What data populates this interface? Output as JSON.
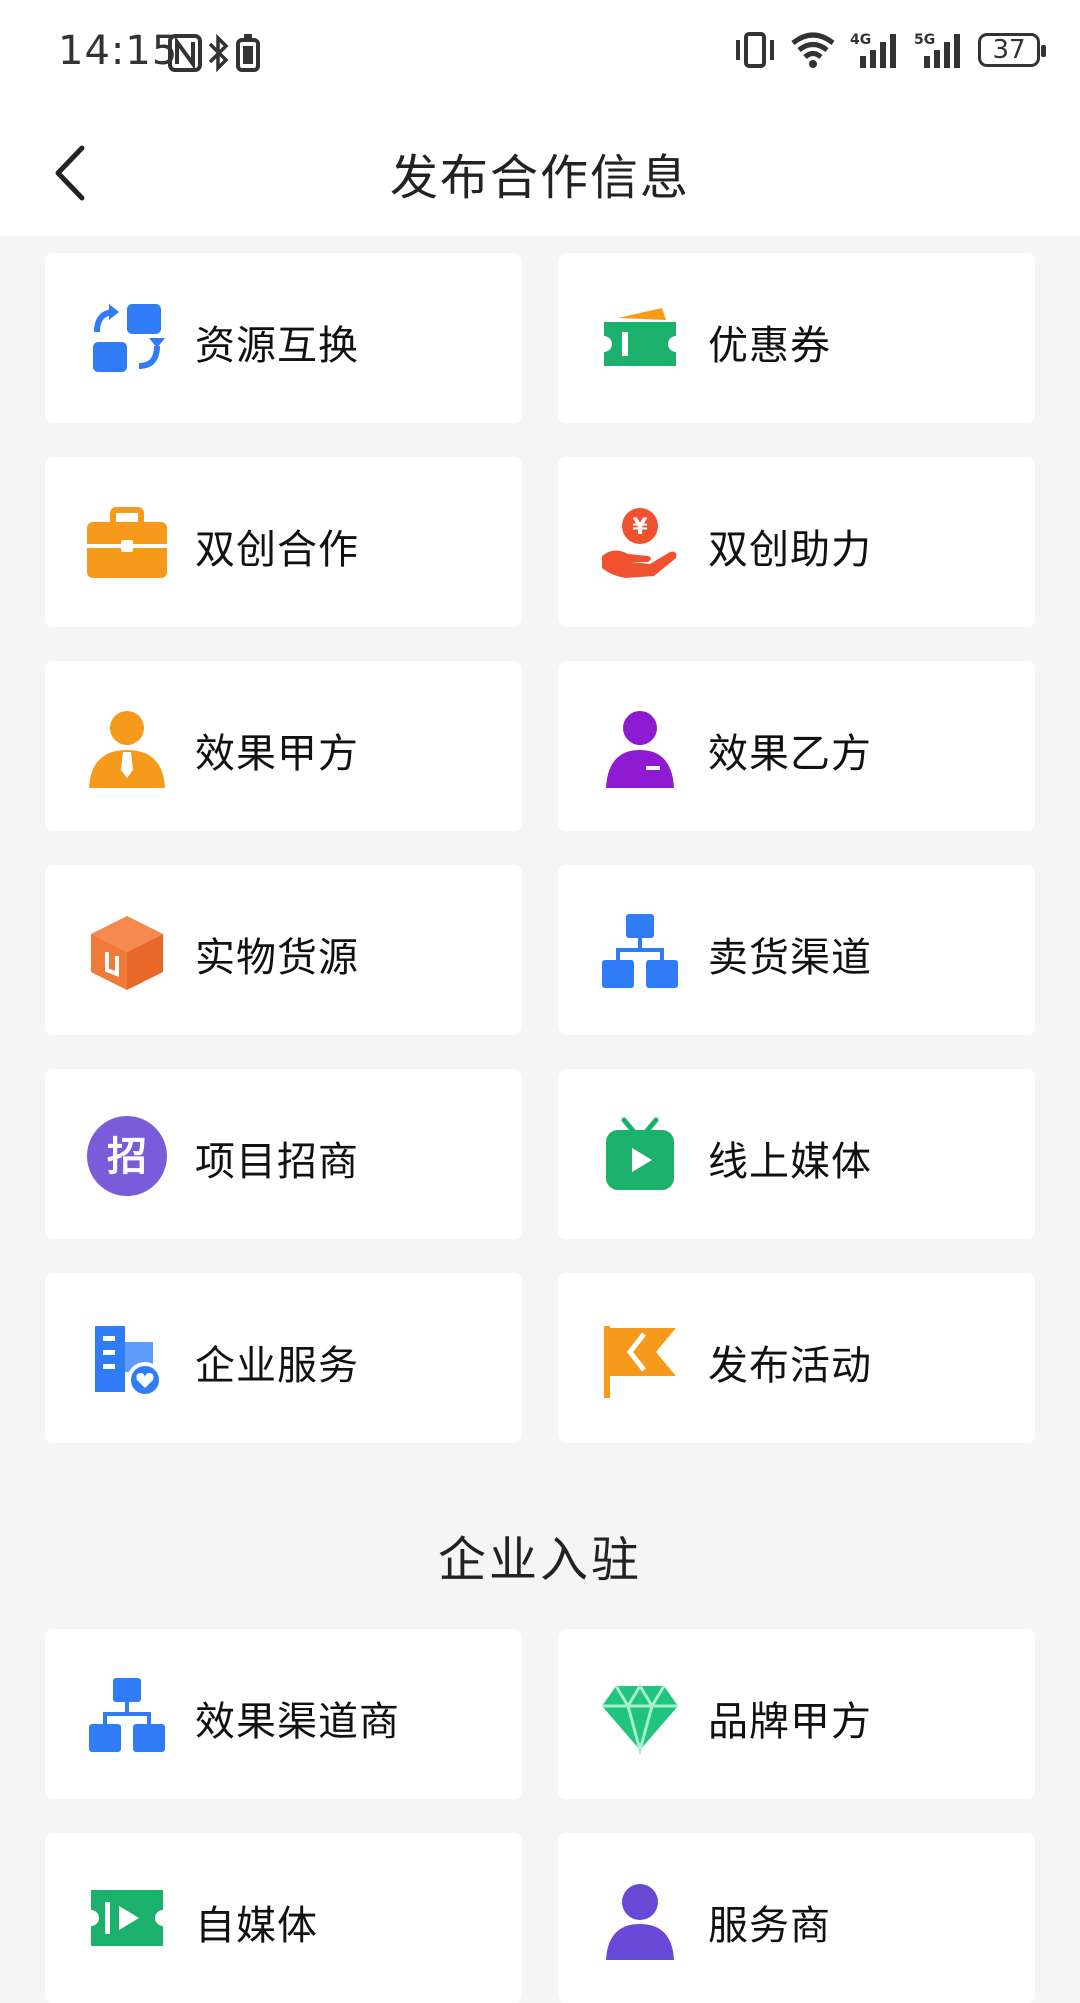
{
  "status_bar": {
    "time": "14:15",
    "battery": "37"
  },
  "nav": {
    "title": "发布合作信息"
  },
  "publish_items": [
    {
      "label": "资源互换",
      "icon": "exchange-icon"
    },
    {
      "label": "优惠券",
      "icon": "coupon-icon"
    },
    {
      "label": "双创合作",
      "icon": "briefcase-icon"
    },
    {
      "label": "双创助力",
      "icon": "money-hand-icon"
    },
    {
      "label": "效果甲方",
      "icon": "person-tie-icon"
    },
    {
      "label": "效果乙方",
      "icon": "person-badge-icon"
    },
    {
      "label": "实物货源",
      "icon": "box-icon"
    },
    {
      "label": "卖货渠道",
      "icon": "channel-tree-icon"
    },
    {
      "label": "项目招商",
      "icon": "zhao-badge-icon"
    },
    {
      "label": "线上媒体",
      "icon": "tv-play-icon"
    },
    {
      "label": "企业服务",
      "icon": "building-heart-icon"
    },
    {
      "label": "发布活动",
      "icon": "flag-icon"
    }
  ],
  "section": {
    "title": "企业入驻"
  },
  "join_items": [
    {
      "label": "效果渠道商",
      "icon": "channel-tree-icon"
    },
    {
      "label": "品牌甲方",
      "icon": "diamond-icon"
    },
    {
      "label": "自媒体",
      "icon": "media-ticket-icon"
    },
    {
      "label": "服务商",
      "icon": "service-person-icon"
    }
  ],
  "colors": {
    "blue": "#2f7cf6",
    "green": "#1bb06b",
    "orange": "#f59a1b",
    "red": "#f0512f",
    "purple": "#8e1bd1",
    "violet": "#7a5bd9",
    "page_bg": "#f5f5f5"
  }
}
